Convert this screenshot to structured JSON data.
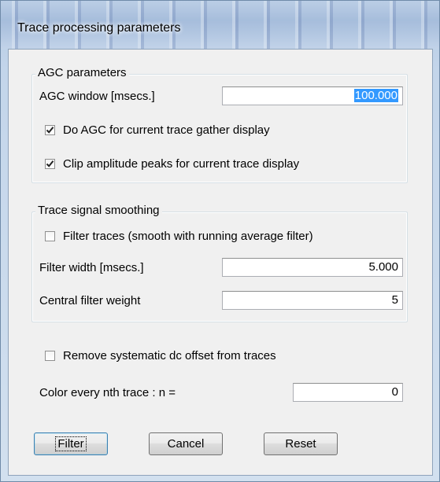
{
  "window": {
    "title": "Trace processing parameters"
  },
  "agc_group": {
    "legend": "AGC parameters",
    "window_label": "AGC window [msecs.]",
    "window_value": "100.000",
    "do_agc_label": "Do AGC for current trace gather display",
    "do_agc_checked": true,
    "clip_label": "Clip amplitude peaks for current trace display",
    "clip_checked": true
  },
  "smoothing_group": {
    "legend": "Trace signal smoothing",
    "filter_traces_label": "Filter traces (smooth with running average filter)",
    "filter_traces_checked": false,
    "filter_width_label": "Filter width [msecs.]",
    "filter_width_value": "5.000",
    "central_weight_label": "Central filter weight",
    "central_weight_value": "5"
  },
  "remove_dc_label": "Remove systematic dc offset from traces",
  "remove_dc_checked": false,
  "color_nth_label": "Color every nth trace : n =",
  "color_nth_value": "0",
  "buttons": {
    "filter": "Filter",
    "cancel": "Cancel",
    "reset": "Reset"
  }
}
